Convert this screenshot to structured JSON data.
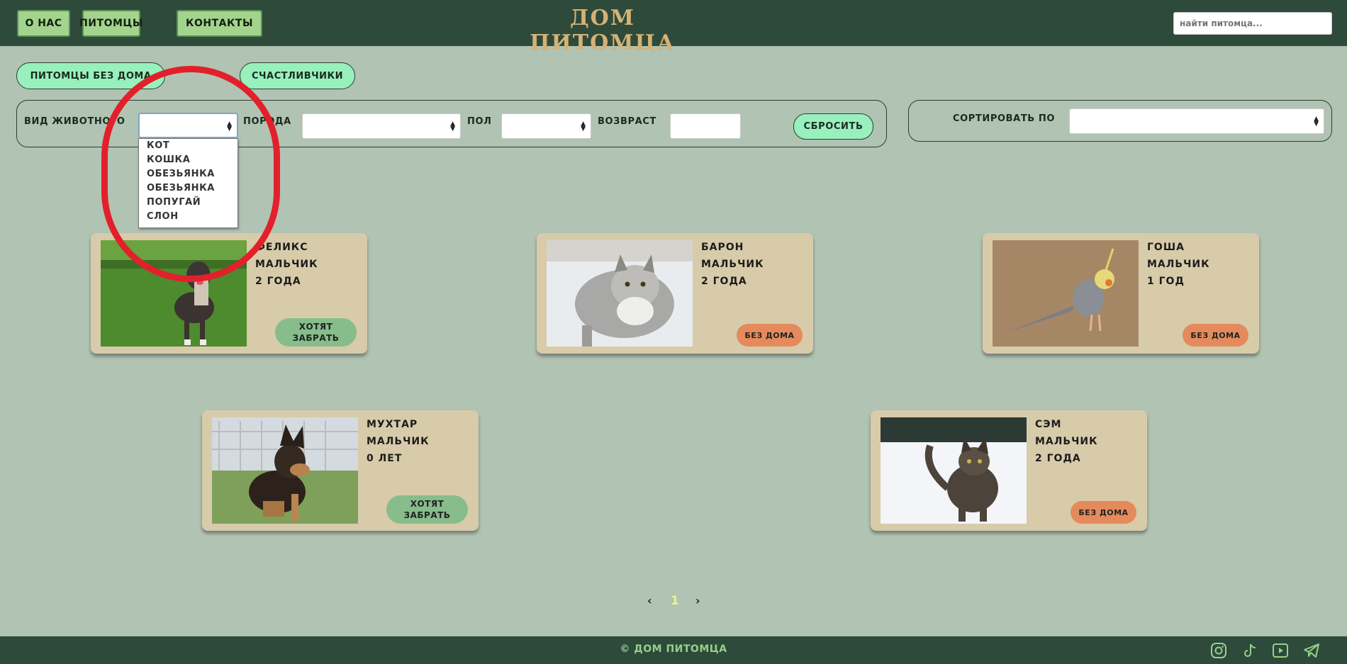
{
  "header": {
    "nav": [
      "о нас",
      "питомцы",
      "контакты"
    ],
    "title": "дом питомца",
    "search_placeholder": "найти питомца..."
  },
  "tabs": [
    "питомцы без дома",
    "счастливчики"
  ],
  "filters": {
    "species_label": "вид животного",
    "breed_label": "порода",
    "sex_label": "пол",
    "age_label": "возвраст",
    "reset_label": "сбросить",
    "species_options": [
      "кот",
      "кошка",
      "обезьянка",
      "обезьянка",
      "попугай",
      "слон"
    ]
  },
  "sort": {
    "label": "сортировать по"
  },
  "pets": [
    {
      "name": "феликс",
      "sex": "мальчик",
      "age": "2 года",
      "status": "хотят забрать",
      "status_type": "want",
      "photo": "dog-pitbull"
    },
    {
      "name": "барон",
      "sex": "мальчик",
      "age": "2 года",
      "status": "без дома",
      "status_type": "home",
      "photo": "cat-fluffy"
    },
    {
      "name": "гоша",
      "sex": "мальчик",
      "age": "1 год",
      "status": "без дома",
      "status_type": "home",
      "photo": "parrot-cockatiel"
    },
    {
      "name": "мухтар",
      "sex": "мальчик",
      "age": "0 лет",
      "status": "хотят забрать",
      "status_type": "want",
      "photo": "dog-shepherd-puppy"
    },
    {
      "name": "сэм",
      "sex": "мальчик",
      "age": "2 года",
      "status": "без дома",
      "status_type": "home",
      "photo": "cat-snow"
    }
  ],
  "pagination": {
    "prev": "‹",
    "current": "1",
    "next": "›"
  },
  "footer": {
    "text": "© дом питомца",
    "social_icons": [
      "instagram-icon",
      "tiktok-icon",
      "youtube-icon",
      "telegram-icon"
    ]
  },
  "colors": {
    "background": "#b1c3b3",
    "header": "#2e4a3b",
    "accent_title": "#d4b275",
    "card": "#d8cbaa",
    "status_want": "#86bd8a",
    "status_home": "#e48a5c",
    "pill": "#98f0bd",
    "annotation": "#e2202b"
  }
}
